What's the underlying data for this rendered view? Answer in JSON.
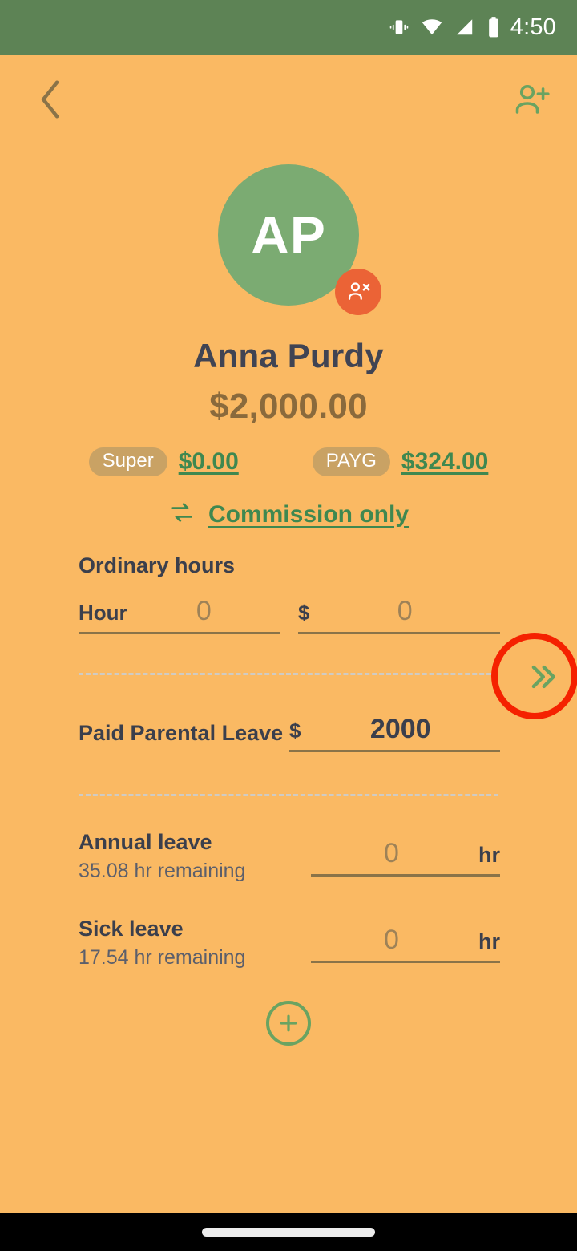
{
  "status_bar": {
    "time": "4:50",
    "icons": [
      "vibrate-icon",
      "wifi-icon",
      "signal-icon",
      "battery-icon"
    ],
    "background_color": "#5d8355"
  },
  "app_bar": {
    "back_icon": "chevron-left-icon",
    "add_person_icon": "person-add-icon"
  },
  "employee": {
    "initials": "AP",
    "name": "Anna Purdy",
    "gross_amount": "$2,000.00",
    "status_badge_icon": "person-remove-icon",
    "avatar_color": "#7bab72",
    "badge_color": "#eb6336"
  },
  "chips": [
    {
      "label": "Super",
      "value": "$0.00"
    },
    {
      "label": "PAYG",
      "value": "$324.00"
    }
  ],
  "commission": {
    "icon": "swap-arrows-icon",
    "label": "Commission only"
  },
  "pay_items": {
    "ordinary_hours": {
      "title": "Ordinary hours",
      "hours_label": "Hour",
      "hours_value": "0",
      "amount_prefix": "$",
      "amount_value": "0",
      "expand_icon": "double-chevron-right-icon"
    },
    "paid_parental_leave": {
      "title": "Paid Parental Leave",
      "amount_prefix": "$",
      "amount_value": "2000"
    },
    "annual_leave": {
      "title": "Annual leave",
      "remaining": "35.08 hr remaining",
      "value": "0",
      "unit": "hr"
    },
    "sick_leave": {
      "title": "Sick leave",
      "remaining": "17.54 hr remaining",
      "value": "0",
      "unit": "hr"
    }
  },
  "add_button": {
    "icon": "plus-circle-icon"
  },
  "annotation": {
    "highlight_color": "#f52100",
    "target": "expand-ordinary-hours-button"
  },
  "theme": {
    "background": "#fab963",
    "accent_green": "#3f8850",
    "chip_background": "#c9a264",
    "heading_text": "#3b3f4c",
    "amount_text": "#8a6a3c"
  }
}
